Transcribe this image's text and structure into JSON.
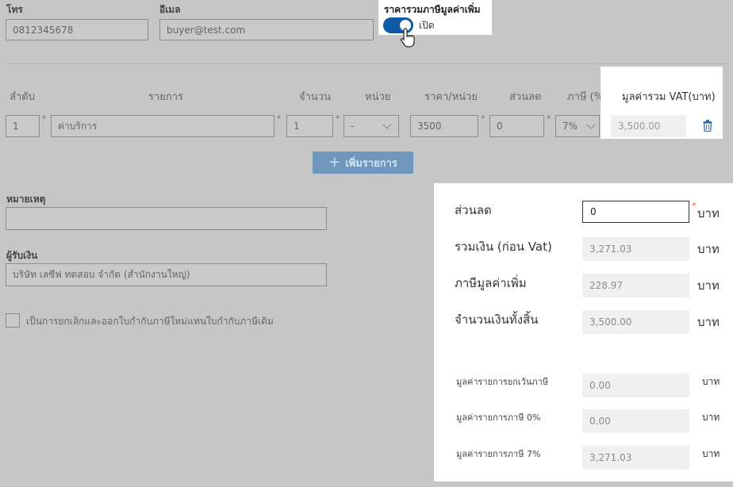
{
  "contact": {
    "phone_label": "โทร",
    "phone_value": "0812345678",
    "email_label": "อีเมล",
    "email_value": "buyer@test.com",
    "vat_inclusive_label": "ราคารวมภาษีมูลค่าเพิ่ม",
    "vat_inclusive_state": "เปิด"
  },
  "items_table": {
    "headers": {
      "seq": "ลำดับ",
      "item": "รายการ",
      "qty": "จำนวน",
      "unit": "หน่วย",
      "price": "ราคา/หน่วย",
      "discount": "ส่วนลด",
      "tax": "ภาษี (%)",
      "total": "มูลค่ารวม VAT(บาท)"
    },
    "rows": [
      {
        "seq": "1",
        "item": "ค่าบริการ",
        "qty": "1",
        "unit": "-",
        "price": "3500",
        "discount": "0",
        "tax": "7%",
        "total": "3,500.00"
      }
    ],
    "required_mark": "*",
    "add_button": "เพิ่มรายการ"
  },
  "remarks": {
    "label": "หมายเหตุ",
    "value": ""
  },
  "payee": {
    "label": "ผู้รับเงิน",
    "value": "บริษัท เลซีฟ ทดสอบ จำกัด (สำนักงานใหญ่)"
  },
  "replace_checkbox_label": "เป็นการยกเลิกและออกใบกำกับภาษีใหม่แทนใบกำกับภาษีเดิม",
  "summary": {
    "discount_label": "ส่วนลด",
    "discount_value": "0",
    "subtotal_label": "รวมเงิน (ก่อน Vat)",
    "subtotal_value": "3,271.03",
    "vat_label": "ภาษีมูลค่าเพิ่ม",
    "vat_value": "228.97",
    "grand_total_label": "จำนวนเงินทั้งสิ้น",
    "grand_total_value": "3,500.00",
    "exempt_label": "มูลค่ารายการยกเว้นภาษี",
    "exempt_value": "0.00",
    "zero_rate_label": "มูลค่ารายการภาษี 0%",
    "zero_rate_value": "0.00",
    "vat7_label": "มูลค่ารายการภาษี 7%",
    "vat7_value": "3,271.03",
    "currency": "บาท"
  },
  "colors": {
    "toggle_on": "#0e5aa7",
    "add_button": "#6f97be",
    "trash_icon": "#2f6fb0",
    "required_red": "#d9534f"
  },
  "icons": [
    "hand-cursor-icon",
    "plus-icon",
    "trash-icon",
    "chevron-down-icon",
    "checkbox-icon"
  ]
}
